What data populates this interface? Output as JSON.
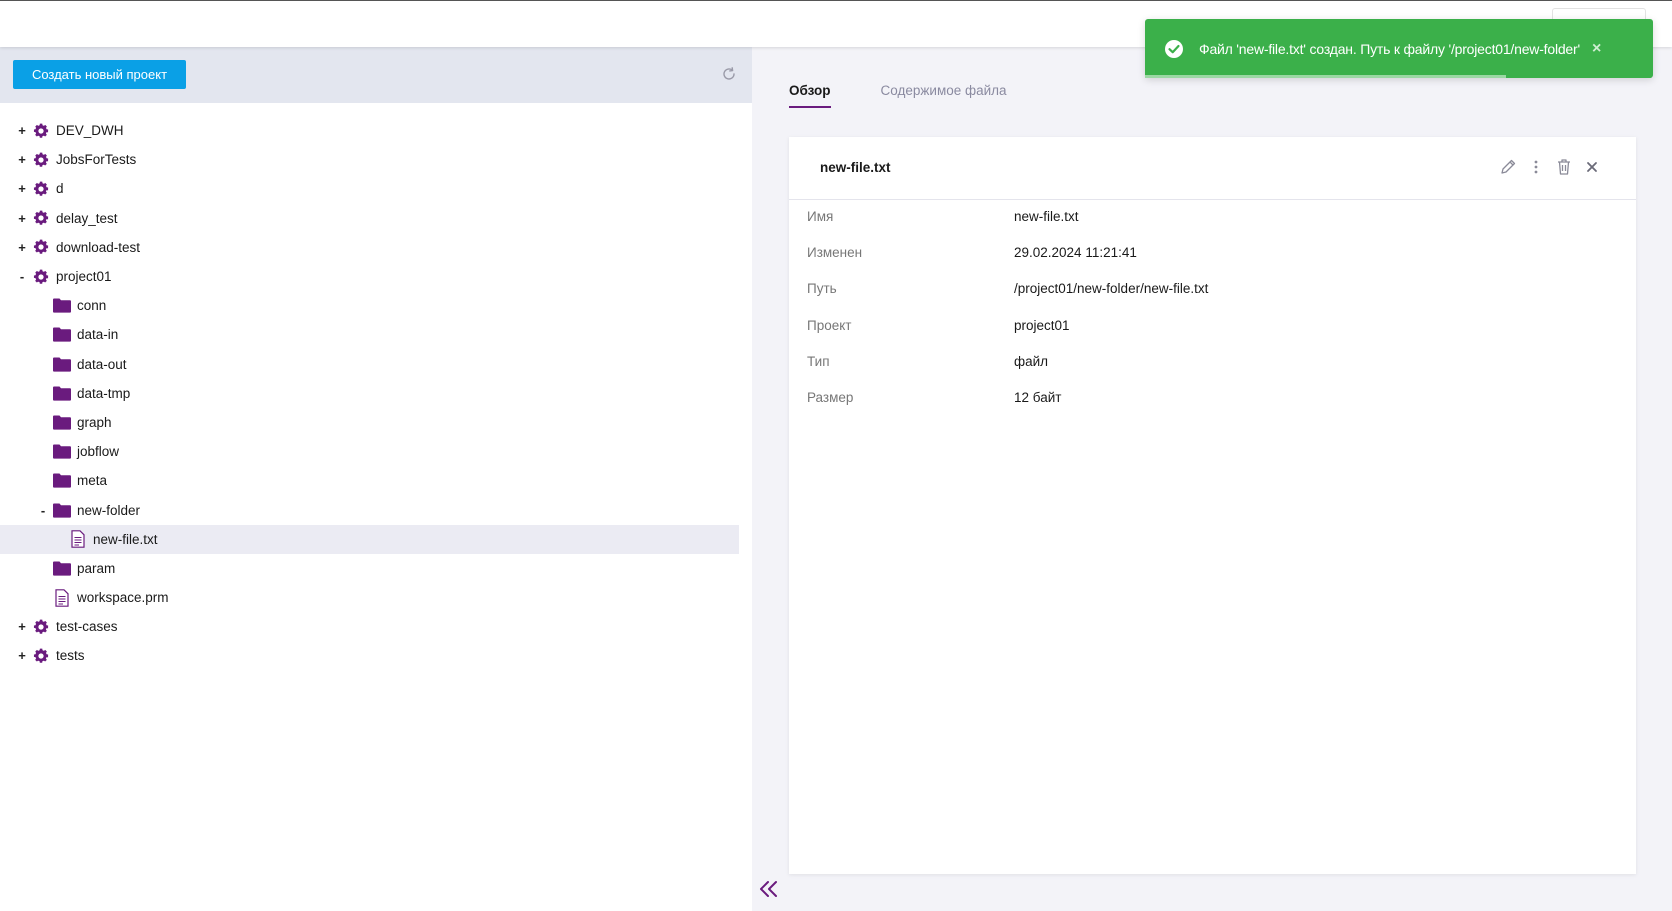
{
  "left_panel": {
    "create_button": "Создать новый проект",
    "tree": [
      {
        "toggle": "+",
        "label": "DEV_DWH",
        "icon": "project-gear-icon",
        "level": 0
      },
      {
        "toggle": "+",
        "label": "JobsForTests",
        "icon": "project-gear-icon",
        "level": 0
      },
      {
        "toggle": "+",
        "label": "d",
        "icon": "project-gear-icon",
        "level": 0
      },
      {
        "toggle": "+",
        "label": "delay_test",
        "icon": "project-gear-icon",
        "level": 0
      },
      {
        "toggle": "+",
        "label": "download-test",
        "icon": "project-gear-icon",
        "level": 0
      },
      {
        "toggle": "-",
        "label": "project01",
        "icon": "project-gear-icon",
        "level": 0
      },
      {
        "toggle": "",
        "label": "conn",
        "icon": "folder-icon",
        "level": 1
      },
      {
        "toggle": "",
        "label": "data-in",
        "icon": "folder-icon",
        "level": 1
      },
      {
        "toggle": "",
        "label": "data-out",
        "icon": "folder-icon",
        "level": 1
      },
      {
        "toggle": "",
        "label": "data-tmp",
        "icon": "folder-icon",
        "level": 1
      },
      {
        "toggle": "",
        "label": "graph",
        "icon": "folder-icon",
        "level": 1
      },
      {
        "toggle": "",
        "label": "jobflow",
        "icon": "folder-icon",
        "level": 1
      },
      {
        "toggle": "",
        "label": "meta",
        "icon": "folder-icon",
        "level": 1
      },
      {
        "toggle": "-",
        "label": "new-folder",
        "icon": "folder-icon",
        "level": 1
      },
      {
        "toggle": "",
        "label": "new-file.txt",
        "icon": "file-icon",
        "level": 2,
        "selected": true
      },
      {
        "toggle": "",
        "label": "param",
        "icon": "folder-icon",
        "level": 1
      },
      {
        "toggle": "",
        "label": "workspace.prm",
        "icon": "file-icon",
        "level": 1
      },
      {
        "toggle": "+",
        "label": "test-cases",
        "icon": "project-gear-icon",
        "level": 0
      },
      {
        "toggle": "+",
        "label": "tests",
        "icon": "project-gear-icon",
        "level": 0
      }
    ]
  },
  "right_panel": {
    "tabs": [
      {
        "label": "Обзор",
        "active": true
      },
      {
        "label": "Содержимое файла",
        "active": false
      }
    ],
    "card": {
      "title": "new-file.txt",
      "properties": [
        {
          "label": "Имя",
          "value": "new-file.txt"
        },
        {
          "label": "Изменен",
          "value": "29.02.2024 11:21:41"
        },
        {
          "label": "Путь",
          "value": "/project01/new-folder/new-file.txt"
        },
        {
          "label": "Проект",
          "value": "project01"
        },
        {
          "label": "Тип",
          "value": "файл"
        },
        {
          "label": "Размер",
          "value": "12 байт"
        }
      ]
    }
  },
  "toast": {
    "message": "Файл 'new-file.txt' создан. Путь к файлу '/project01/new-folder'",
    "close": "×",
    "progress": 0.71
  },
  "colors": {
    "accent": "#6a1b7e",
    "primary_button": "#0aa0e6",
    "toast_success": "#3bb04a"
  }
}
